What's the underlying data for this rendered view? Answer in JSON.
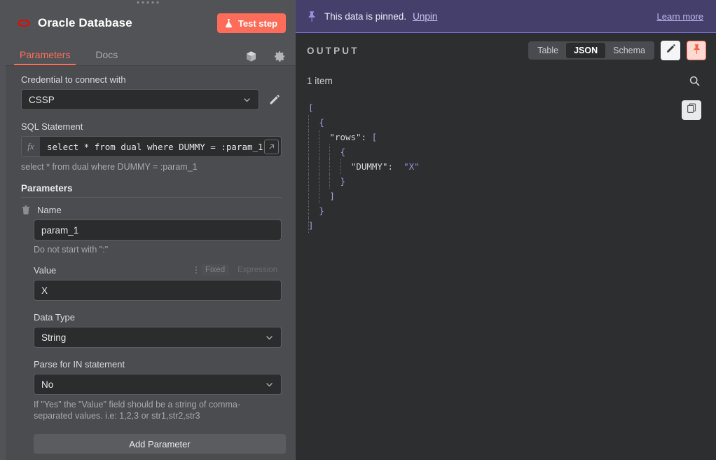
{
  "node": {
    "title": "Oracle Database",
    "logo_icon": "oracle-logo-icon",
    "test_step_label": "Test step",
    "test_step_icon": "flask-icon",
    "accent_color": "#ff6d5a",
    "tabs": [
      {
        "label": "Parameters",
        "active": true
      },
      {
        "label": "Docs",
        "active": false
      }
    ],
    "tab_icons": [
      {
        "name": "cube-icon"
      },
      {
        "name": "gear-icon"
      }
    ]
  },
  "form": {
    "credential": {
      "label": "Credential to connect with",
      "value": "CSSP",
      "chevron_icon": "chevron-down-icon",
      "edit_icon": "pencil-icon"
    },
    "sql": {
      "label": "SQL Statement",
      "fx_label": "fx",
      "value": "select * from dual where DUMMY = :param_1",
      "expand_icon": "expand-icon",
      "preview": "select * from dual where DUMMY = :param_1"
    },
    "parameters_section_title": "Parameters",
    "parameter": {
      "delete_icon": "trash-icon",
      "name_label": "Name",
      "name_value": "param_1",
      "name_hint": "Do not start with \":\"",
      "value_label": "Value",
      "value_value": "X",
      "drag_icon": "drag-dots-icon",
      "mode_fixed": "Fixed",
      "mode_expression": "Expression",
      "data_type_label": "Data Type",
      "data_type_value": "String",
      "parse_in_label": "Parse for IN statement",
      "parse_in_value": "No",
      "parse_in_hint": "If \"Yes\" the \"Value\" field should be a string of comma-separated values. i.e: 1,2,3 or str1,str2,str3"
    },
    "add_parameter_label": "Add Parameter"
  },
  "output": {
    "pin_banner": {
      "icon": "pin-icon",
      "text": "This data is pinned.",
      "unpin_label": "Unpin",
      "learn_more_label": "Learn more",
      "background_color": "#45406b"
    },
    "title": "OUTPUT",
    "view_tabs": [
      {
        "label": "Table",
        "active": false
      },
      {
        "label": "JSON",
        "active": true
      },
      {
        "label": "Schema",
        "active": false
      }
    ],
    "edit_icon": "pencil-icon",
    "pin_toggle_icon": "pin-icon",
    "item_count": "1 item",
    "search_icon": "search-icon",
    "copy_icon": "copy-icon",
    "json_lines": [
      {
        "indent": 0,
        "guides": 0,
        "tokens": [
          {
            "t": "[",
            "c": "punct"
          }
        ]
      },
      {
        "indent": 1,
        "guides": 1,
        "tokens": [
          {
            "t": "{",
            "c": "punct"
          }
        ]
      },
      {
        "indent": 2,
        "guides": 2,
        "tokens": [
          {
            "t": "\"rows\"",
            "c": "key"
          },
          {
            "t": ": ",
            "c": "key"
          },
          {
            "t": "[",
            "c": "punct"
          }
        ]
      },
      {
        "indent": 3,
        "guides": 3,
        "tokens": [
          {
            "t": "{",
            "c": "punct"
          }
        ]
      },
      {
        "indent": 4,
        "guides": 4,
        "tokens": [
          {
            "t": "\"DUMMY\"",
            "c": "key"
          },
          {
            "t": ":  ",
            "c": "key"
          },
          {
            "t": "\"X\"",
            "c": "str"
          }
        ]
      },
      {
        "indent": 3,
        "guides": 3,
        "tokens": [
          {
            "t": "}",
            "c": "punct"
          }
        ]
      },
      {
        "indent": 2,
        "guides": 2,
        "tokens": [
          {
            "t": "]",
            "c": "punct"
          }
        ]
      },
      {
        "indent": 1,
        "guides": 1,
        "tokens": [
          {
            "t": "}",
            "c": "punct"
          }
        ]
      },
      {
        "indent": 0,
        "guides": 1,
        "tokens": [
          {
            "t": "]",
            "c": "punct"
          }
        ]
      }
    ]
  }
}
